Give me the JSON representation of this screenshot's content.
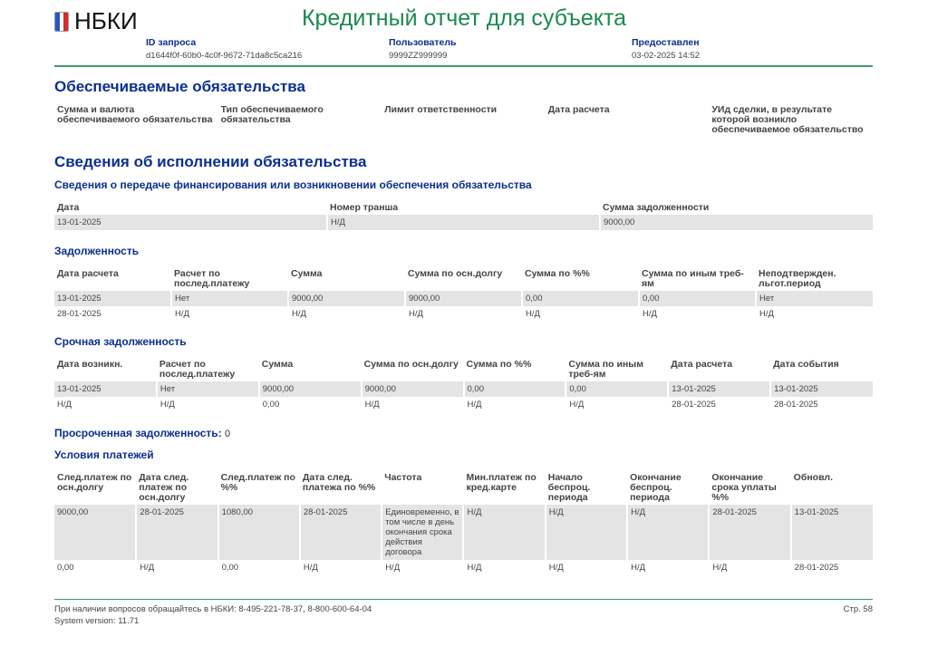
{
  "header": {
    "logo_text": "НБКИ",
    "title": "Кредитный отчет для субъекта",
    "meta": [
      {
        "label": "ID запроса",
        "value": "d1644f0f-60b0-4c0f-9672-71da8c5ca216"
      },
      {
        "label": "Пользователь",
        "value": "9999ZZ999999"
      },
      {
        "label": "Предоставлен",
        "value": "03-02-2025 14:52"
      }
    ]
  },
  "secured": {
    "title": "Обеспечиваемые обязательства",
    "headers": [
      "Сумма и валюта обеспечиваемого обязательства",
      "Тип обеспечиваемого обязательства",
      "Лимит ответственности",
      "Дата расчета",
      "УИд сделки, в результате которой возникло обеспечиваемое обязательство"
    ],
    "rows": []
  },
  "execution": {
    "title": "Сведения об исполнении обязательства",
    "financing": {
      "title": "Сведения о передаче финансирования или возникновении обеспечения обязательства",
      "headers": [
        "Дата",
        "Номер транша",
        "Сумма задолженности"
      ],
      "rows": [
        [
          "13-01-2025",
          "Н/Д",
          "9000,00"
        ]
      ]
    },
    "debt": {
      "title": "Задолженность",
      "headers": [
        "Дата расчета",
        "Расчет по послед.платежу",
        "Сумма",
        "Сумма по осн.долгу",
        "Сумма по %%",
        "Сумма по иным треб-ям",
        "Неподтвержден. льгот.период"
      ],
      "rows": [
        [
          "13-01-2025",
          "Нет",
          "9000,00",
          "9000,00",
          "0,00",
          "0,00",
          "Нет"
        ],
        [
          "28-01-2025",
          "Н/Д",
          "Н/Д",
          "Н/Д",
          "Н/Д",
          "Н/Д",
          "Н/Д"
        ]
      ]
    },
    "urgent": {
      "title": "Срочная задолженность",
      "headers": [
        "Дата возникн.",
        "Расчет по послед.платежу",
        "Сумма",
        "Сумма по осн.долгу",
        "Сумма по %%",
        "Сумма по иным треб-ям",
        "Дата расчета",
        "Дата события"
      ],
      "rows": [
        [
          "13-01-2025",
          "Нет",
          "9000,00",
          "9000,00",
          "0,00",
          "0,00",
          "13-01-2025",
          "13-01-2025"
        ],
        [
          "Н/Д",
          "Н/Д",
          "0,00",
          "Н/Д",
          "Н/Д",
          "Н/Д",
          "28-01-2025",
          "28-01-2025"
        ]
      ]
    },
    "overdue": {
      "title": "Просроченная задолженность:",
      "value": "0"
    },
    "payments": {
      "title": "Условия платежей",
      "headers": [
        "След.платеж по осн.долгу",
        "Дата след. платеж по осн.долгу",
        "След.платеж по %%",
        "Дата след. платежа по %%",
        "Частота",
        "Мин.платеж по кред.карте",
        "Начало беспроц. периода",
        "Окончание беспроц. периода",
        "Окончание срока уплаты %%",
        "Обновл."
      ],
      "rows": [
        [
          "9000,00",
          "28-01-2025",
          "1080,00",
          "28-01-2025",
          "Единовременно, в том числе в день окончания срока действия договора",
          "Н/Д",
          "Н/Д",
          "Н/Д",
          "28-01-2025",
          "13-01-2025"
        ],
        [
          "0,00",
          "Н/Д",
          "0,00",
          "Н/Д",
          "Н/Д",
          "Н/Д",
          "Н/Д",
          "Н/Д",
          "Н/Д",
          "28-01-2025"
        ]
      ]
    }
  },
  "footer": {
    "contact": "При наличии вопросов обращайтесь в НБКИ: 8-495-221-78-37, 8-800-600-64-04",
    "version": "System version: 11.71",
    "page": "Стр. 58"
  },
  "colors": {
    "title_green": "#1b8a4f",
    "heading_blue": "#0b2f8f",
    "row_grey": "#e4e4e4"
  }
}
